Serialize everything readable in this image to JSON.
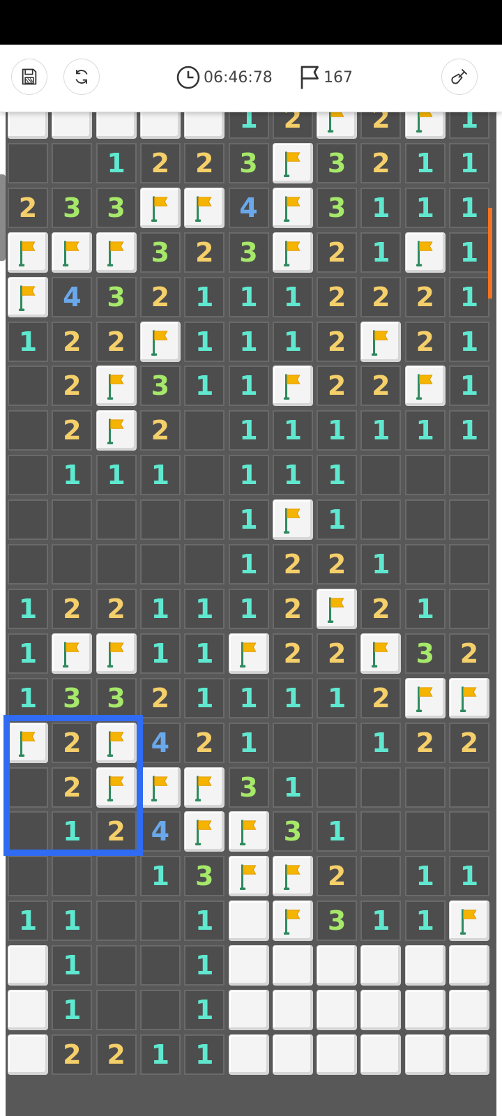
{
  "toolbar": {
    "save_icon": "floppy-disk-icon",
    "restart_icon": "refresh-icon",
    "timer_icon": "clock-icon",
    "timer": "06:46:78",
    "flag_icon": "flag-outline-icon",
    "flags_remaining": "167",
    "tool_icon": "shovel-icon"
  },
  "colors": {
    "one": "#5fe8cf",
    "two": "#f5cf6a",
    "three": "#a6e86a",
    "four": "#6aa8ec",
    "flag": "#f5b400",
    "selection": "#2f6bf3"
  },
  "board": {
    "legend": "digits = revealed number, 'F' = flagged cell, 'H' = unrevealed cell, '.' = revealed empty",
    "rows": [
      [
        "H",
        "H",
        "H",
        "H",
        "H",
        "1",
        "2",
        "F",
        "2",
        "F",
        "1"
      ],
      [
        ".",
        ".",
        "1",
        "2",
        "2",
        "3",
        "F",
        "3",
        "2",
        "1",
        "1"
      ],
      [
        "2",
        "3",
        "3",
        "F",
        "F",
        "4",
        "F",
        "3",
        "1",
        "1",
        "1"
      ],
      [
        "F",
        "F",
        "F",
        "3",
        "2",
        "3",
        "F",
        "2",
        "1",
        "F",
        "1"
      ],
      [
        "F",
        "4",
        "3",
        "2",
        "1",
        "1",
        "1",
        "2",
        "2",
        "2",
        "1"
      ],
      [
        "1",
        "2",
        "2",
        "F",
        "1",
        "1",
        "1",
        "2",
        "F",
        "2",
        "1"
      ],
      [
        ".",
        "2",
        "F",
        "3",
        "1",
        "1",
        "F",
        "2",
        "2",
        "F",
        "1"
      ],
      [
        ".",
        "2",
        "F",
        "2",
        ".",
        "1",
        "1",
        "1",
        "1",
        "1",
        "1"
      ],
      [
        ".",
        "1",
        "1",
        "1",
        ".",
        "1",
        "1",
        "1",
        ".",
        ".",
        "."
      ],
      [
        ".",
        ".",
        ".",
        ".",
        ".",
        "1",
        "F",
        "1",
        ".",
        ".",
        "."
      ],
      [
        ".",
        ".",
        ".",
        ".",
        ".",
        "1",
        "2",
        "2",
        "1",
        ".",
        "."
      ],
      [
        "1",
        "2",
        "2",
        "1",
        "1",
        "1",
        "2",
        "F",
        "2",
        "1",
        "."
      ],
      [
        "1",
        "F",
        "F",
        "1",
        "1",
        "F",
        "2",
        "2",
        "F",
        "3",
        "2"
      ],
      [
        "1",
        "3",
        "3",
        "2",
        "1",
        "1",
        "1",
        "1",
        "2",
        "F",
        "F"
      ],
      [
        "F",
        "2",
        "F",
        "4",
        "2",
        "1",
        ".",
        ".",
        "1",
        "2",
        "2"
      ],
      [
        ".",
        "2",
        "F",
        "F",
        "F",
        "3",
        "1",
        ".",
        ".",
        ".",
        "."
      ],
      [
        ".",
        "1",
        "2",
        "4",
        "F",
        "F",
        "3",
        "1",
        ".",
        ".",
        "."
      ],
      [
        ".",
        ".",
        ".",
        "1",
        "3",
        "F",
        "F",
        "2",
        ".",
        "1",
        "1"
      ],
      [
        "1",
        "1",
        ".",
        ".",
        "1",
        "H",
        "F",
        "3",
        "1",
        "1",
        "F"
      ],
      [
        "H",
        "1",
        ".",
        ".",
        "1",
        "H",
        "H",
        "H",
        "H",
        "H",
        "H"
      ],
      [
        "H",
        "1",
        ".",
        ".",
        "1",
        "H",
        "H",
        "H",
        "H",
        "H",
        "H"
      ],
      [
        "H",
        "2",
        "2",
        "1",
        "1",
        "H",
        "H",
        "H",
        "H",
        "H",
        "H"
      ]
    ]
  }
}
